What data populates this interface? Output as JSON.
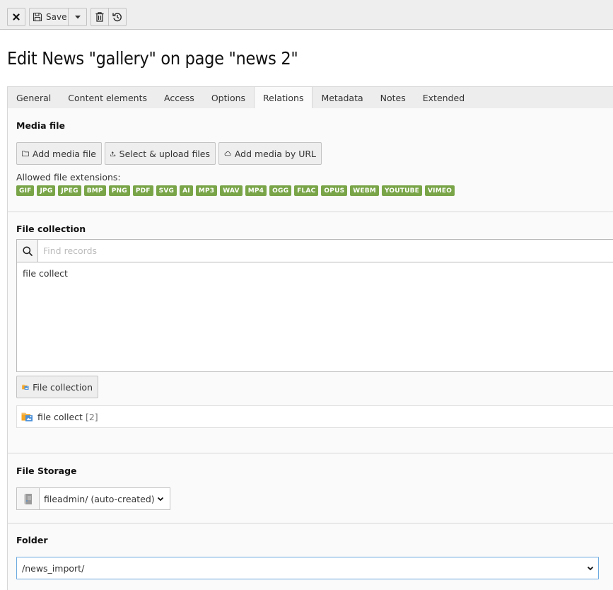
{
  "toolbar": {
    "close_label": "Close",
    "save_label": "Save",
    "save_dropdown_label": "More save options",
    "delete_label": "Delete",
    "history_label": "History"
  },
  "page": {
    "title": "Edit News \"gallery\" on page \"news 2\""
  },
  "tabs": [
    {
      "label": "General",
      "active": false
    },
    {
      "label": "Content elements",
      "active": false
    },
    {
      "label": "Access",
      "active": false
    },
    {
      "label": "Options",
      "active": false
    },
    {
      "label": "Relations",
      "active": true
    },
    {
      "label": "Metadata",
      "active": false
    },
    {
      "label": "Notes",
      "active": false
    },
    {
      "label": "Extended",
      "active": false
    }
  ],
  "media_file": {
    "label": "Media file",
    "buttons": {
      "add_media_file": "Add media file",
      "select_upload": "Select & upload files",
      "add_by_url": "Add media by URL"
    },
    "allowed_label": "Allowed file extensions:",
    "extensions": [
      "GIF",
      "JPG",
      "JPEG",
      "BMP",
      "PNG",
      "PDF",
      "SVG",
      "AI",
      "MP3",
      "WAV",
      "MP4",
      "OGG",
      "FLAC",
      "OPUS",
      "WEBM",
      "YOUTUBE",
      "VIMEO"
    ],
    "badge_color": "#79a548"
  },
  "file_collection": {
    "label": "File collection",
    "search_placeholder": "Find records",
    "search_value": "",
    "options": [
      "file collect"
    ],
    "add_button": "File collection",
    "selected_record": {
      "title": "file collect",
      "count": "[2]"
    }
  },
  "file_storage": {
    "label": "File Storage",
    "selected": "fileadmin/ (auto-created)"
  },
  "folder": {
    "label": "Folder",
    "selected": "/news_import/",
    "focus_color": "#6daae0"
  }
}
